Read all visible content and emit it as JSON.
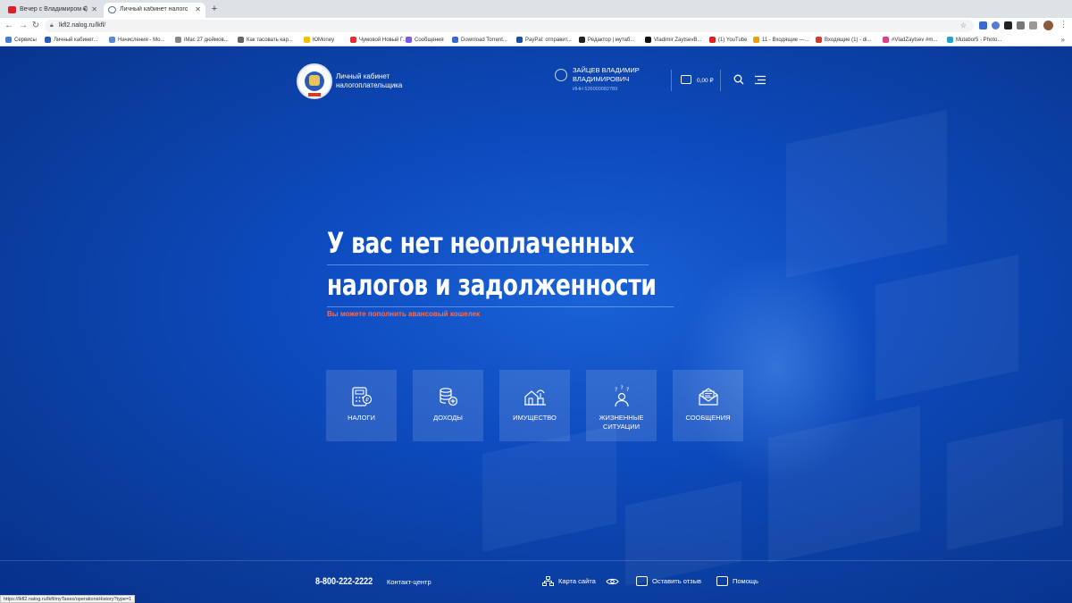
{
  "browser": {
    "tabs": [
      {
        "title": "Вечер с Владимиром Со..."
      },
      {
        "title": "Личный кабинет налогоплате..."
      }
    ],
    "url": "lkfl2.nalog.ru/lkfl/",
    "bookmarks": [
      {
        "label": "Сервисы",
        "color": "#4a7bd0"
      },
      {
        "label": "Личный кабинет...",
        "color": "#2a5ab8"
      },
      {
        "label": "Начисления - Мо...",
        "color": "#5a8bd8"
      },
      {
        "label": "iMac 27 дюймов...",
        "color": "#888888"
      },
      {
        "label": "Как тасовать кар...",
        "color": "#666666"
      },
      {
        "label": "ЮMoney",
        "color": "#f2c200"
      },
      {
        "label": "Чумовой Новый Г...",
        "color": "#e03030"
      },
      {
        "label": "Сообщения",
        "color": "#7a5ae0"
      },
      {
        "label": "Download Torrent...",
        "color": "#3a6ad0"
      },
      {
        "label": "PayPal: отправит...",
        "color": "#1f4fa0"
      },
      {
        "label": "Редактор | мутаб...",
        "color": "#222222"
      },
      {
        "label": "Vladimir ZaytsevВ...",
        "color": "#111111"
      },
      {
        "label": "(1) YouTube",
        "color": "#e02020"
      },
      {
        "label": "11 - Входящие —...",
        "color": "#f2a000"
      },
      {
        "label": "Входящие (1) - di...",
        "color": "#d23a2a"
      },
      {
        "label": "#VladZaytsev #m...",
        "color": "#e0408a"
      },
      {
        "label": "Mutabor5 - Photo...",
        "color": "#2aa0d0"
      }
    ],
    "status_url": "https://lkfl2.nalog.ru/lkfl/myTaxes/operationsHistory?type=1"
  },
  "header": {
    "brand": "Личный кабинет налогоплательщика",
    "user_name": "ЗАЙЦЕВ ВЛАДИМИР ВЛАДИМИРОВИЧ",
    "inn": "ИНН 526000082789",
    "wallet": "0,00 ₽"
  },
  "hero": {
    "line1": "У вас нет неоплаченных",
    "line2": "налогов и задолженности",
    "promo": "Вы можете пополнить авансовый кошелек"
  },
  "tiles": [
    {
      "label": "НАЛОГИ",
      "icon": "calculator-icon"
    },
    {
      "label": "ДОХОДЫ",
      "icon": "coins-icon"
    },
    {
      "label": "ИМУЩЕСТВО",
      "icon": "property-icon"
    },
    {
      "label": "ЖИЗНЕННЫЕ СИТУАЦИИ",
      "icon": "person-questions-icon"
    },
    {
      "label": "СООБЩЕНИЯ",
      "icon": "envelope-icon"
    }
  ],
  "footer": {
    "phone": "8-800-222-2222",
    "contact": "Контакт-центр",
    "sitemap": "Карта сайта",
    "feedback": "Оставить отзыв",
    "help": "Помощь"
  }
}
